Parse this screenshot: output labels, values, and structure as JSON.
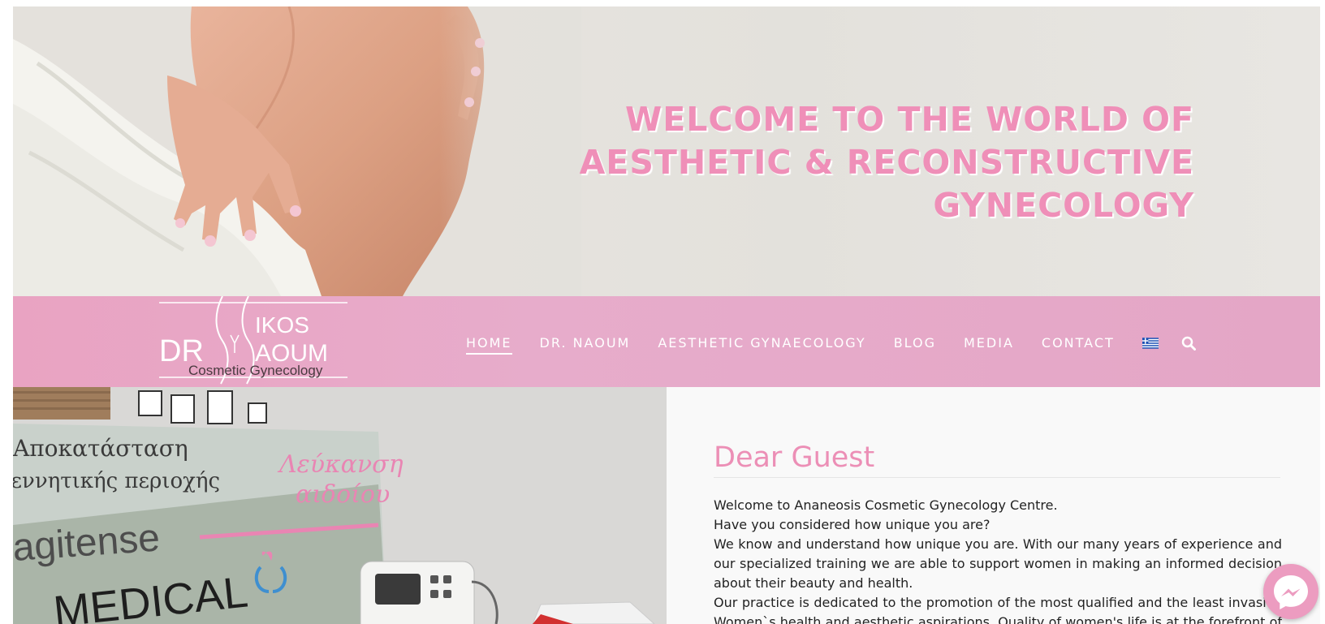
{
  "hero": {
    "title_lines": [
      "WELCOME TO THE WORLD OF",
      "AESTHETIC & RECONSTRUCTIVE",
      "GYNECOLOGY"
    ]
  },
  "logo": {
    "line1": "DR",
    "line2a": "IKOS",
    "line2b": "AOUM",
    "subtitle": "Cosmetic Gynecology"
  },
  "nav": {
    "items": [
      {
        "label": "HOME",
        "active": true
      },
      {
        "label": "DR. NAOUM"
      },
      {
        "label": "AESTHETIC GYNAECOLOGY"
      },
      {
        "label": "BLOG"
      },
      {
        "label": "MEDIA"
      },
      {
        "label": "CONTACT"
      }
    ],
    "flag_icon": "greek-flag-icon",
    "search_icon": "search-icon"
  },
  "photo": {
    "sign_line1": "Αποκατάσταση",
    "sign_line2": "γεννητικής περιοχής",
    "sign_script1": "Λεύκανση",
    "sign_script2": "αιδοίου",
    "sign_brand": "agitense",
    "sign_medical": "MEDICAL"
  },
  "content": {
    "heading": "Dear Guest",
    "paragraphs": [
      "Welcome to Ananeosis Cosmetic Gynecology Centre.",
      "Have you considered how unique you are?",
      "We know and understand how unique you are. With our many years of experience and our specialized training we are able to support women in making an informed decision about their beauty and health.",
      "Our practice is dedicated to the promotion of the most qualified and the least invasive Women`s health and aesthetic aspirations. Quality of women's life is at the forefront of our"
    ]
  },
  "colors": {
    "accent_pink": "#ec8fb6",
    "nav_pink": "#e7accb",
    "text": "#222222"
  },
  "messenger_icon": "messenger-icon"
}
